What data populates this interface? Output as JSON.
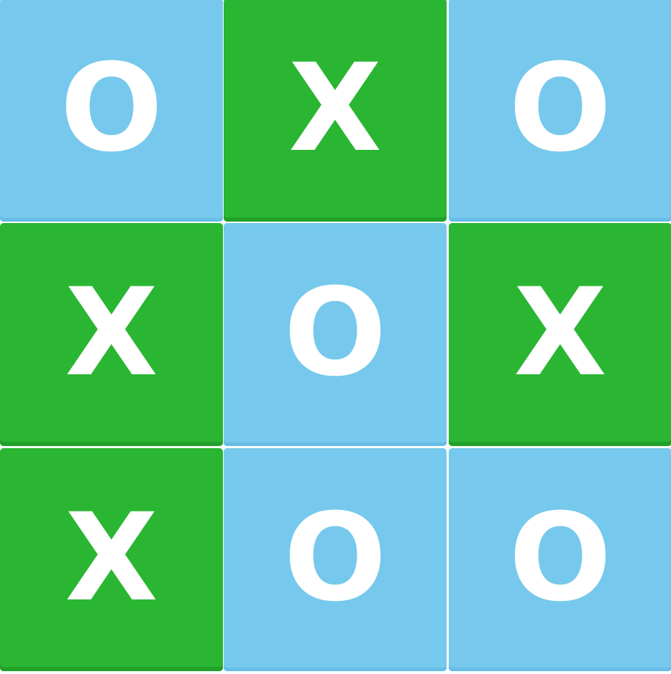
{
  "board": {
    "cells": [
      {
        "mark": "O",
        "player": "o"
      },
      {
        "mark": "X",
        "player": "x"
      },
      {
        "mark": "O",
        "player": "o"
      },
      {
        "mark": "X",
        "player": "x"
      },
      {
        "mark": "O",
        "player": "o"
      },
      {
        "mark": "X",
        "player": "x"
      },
      {
        "mark": "X",
        "player": "x"
      },
      {
        "mark": "O",
        "player": "o"
      },
      {
        "mark": "O",
        "player": "o"
      }
    ]
  },
  "colors": {
    "x_tile": "#2ab632",
    "o_tile": "#76c9ec",
    "mark": "#ffffff",
    "background": "#ffffff"
  }
}
